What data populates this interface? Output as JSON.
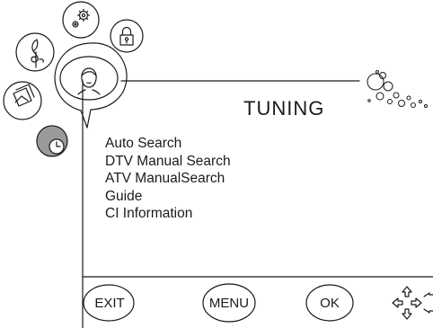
{
  "screen": {
    "title": "TUNING",
    "menu_items": [
      "Auto Search",
      "DTV Manual Search",
      "ATV ManualSearch",
      "Guide",
      "CI Information"
    ]
  },
  "buttons": {
    "exit_label": "EXIT",
    "menu_label": "MENU",
    "ok_label": "OK"
  },
  "category_icons": [
    "settings-icon",
    "lock-icon",
    "music-icon",
    "picture-icon",
    "user-face-icon",
    "clock-icon"
  ],
  "nav_icon": "direction-arrows-icon",
  "colors": {
    "line": "#1a1a1a",
    "background": "#ffffff"
  }
}
